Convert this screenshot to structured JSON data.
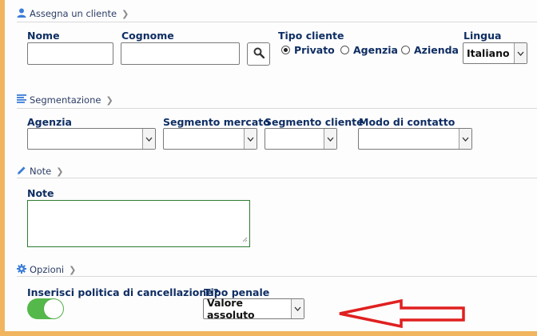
{
  "colors": {
    "accent_bar": "#f0b55e",
    "label": "#0f2e63",
    "toggle_on": "#54b84a",
    "arrow": "#e02020"
  },
  "sections": {
    "client": {
      "icon": "user-icon",
      "title": "Assegna un cliente"
    },
    "segmentation": {
      "icon": "list-icon",
      "title": "Segmentazione"
    },
    "notes": {
      "icon": "pencil-icon",
      "title": "Note"
    },
    "options": {
      "icon": "gear-icon",
      "title": "Opzioni"
    }
  },
  "client": {
    "nome_label": "Nome",
    "nome_value": "",
    "cognome_label": "Cognome",
    "cognome_value": "",
    "tipo_label": "Tipo cliente",
    "tipo_options": [
      "Privato",
      "Agenzia",
      "Azienda"
    ],
    "tipo_selected": "Privato",
    "lingua_label": "Lingua",
    "lingua_value": "Italiano"
  },
  "segmentation": {
    "agenzia_label": "Agenzia",
    "segmento_mercato_label": "Segmento mercato",
    "segmento_cliente_label": "Segmento cliente",
    "modo_contatto_label": "Modo di contatto"
  },
  "notes": {
    "note_label": "Note",
    "note_value": ""
  },
  "options": {
    "cancellation_label": "Inserisci politica di cancellazione?",
    "cancellation_enabled": true,
    "penalty_label": "Tipo penale",
    "penalty_value": "Valore assoluto"
  }
}
